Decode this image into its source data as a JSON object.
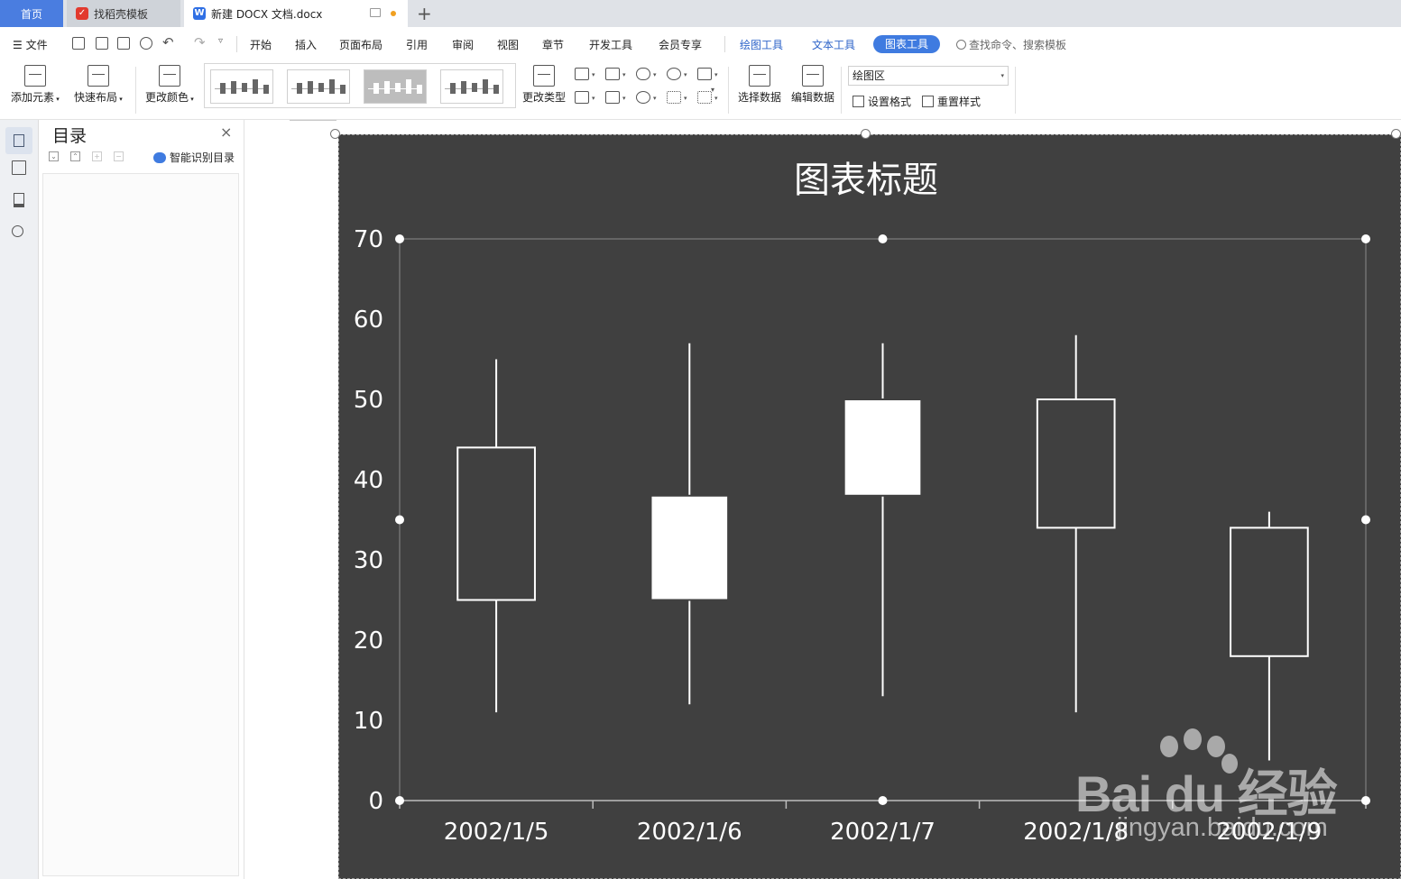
{
  "tabs": {
    "home": "首页",
    "templates": "找稻壳模板",
    "document": "新建 DOCX 文档.docx",
    "add": "+"
  },
  "menu": {
    "file": "文件",
    "items": [
      "开始",
      "插入",
      "页面布局",
      "引用",
      "审阅",
      "视图",
      "章节",
      "开发工具",
      "会员专享"
    ],
    "drawing_tools": "绘图工具",
    "text_tools": "文本工具",
    "chart_tools": "图表工具",
    "search_placeholder": "查找命令、搜索模板"
  },
  "ribbon": {
    "add_element": "添加元素",
    "quick_layout": "快速布局",
    "change_color": "更改颜色",
    "change_type": "更改类型",
    "select_data": "选择数据",
    "edit_data": "编辑数据",
    "area_select_value": "绘图区",
    "set_format": "设置格式",
    "reset_style": "重置样式"
  },
  "toc": {
    "title": "目录",
    "close": "×",
    "smart_detect": "智能识别目录"
  },
  "watermark": {
    "logo": "Bai du 经验",
    "url": "jingyan.baidu.com"
  },
  "colors": {
    "accent": "#3f7be0",
    "chart_bg": "#404040",
    "candle_line": "#ffffff"
  },
  "chart_data": {
    "type": "candlestick",
    "title": "图表标题",
    "categories": [
      "2002/1/5",
      "2002/1/6",
      "2002/1/7",
      "2002/1/8",
      "2002/1/9"
    ],
    "series": [
      {
        "open": 44,
        "high": 55,
        "low": 11,
        "close": 25
      },
      {
        "open": 25,
        "high": 57,
        "low": 12,
        "close": 38
      },
      {
        "open": 38,
        "high": 57,
        "low": 13,
        "close": 50
      },
      {
        "open": 50,
        "high": 58,
        "low": 11,
        "close": 34
      },
      {
        "open": 34,
        "high": 36,
        "low": 5,
        "close": 18
      }
    ],
    "yticks": [
      "0",
      "10",
      "20",
      "30",
      "40",
      "50",
      "60",
      "70"
    ],
    "ylim": [
      0,
      70
    ],
    "grid": false,
    "legend": "none"
  }
}
